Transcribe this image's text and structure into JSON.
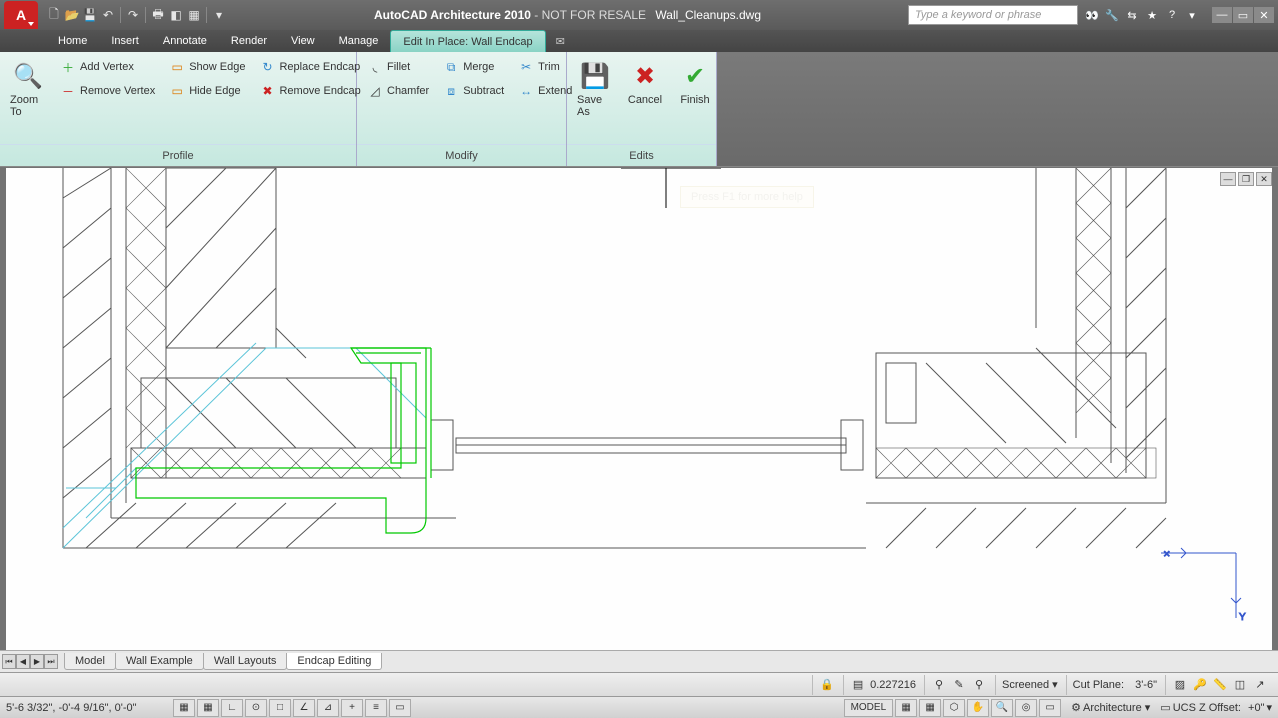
{
  "title": {
    "app": "AutoCAD Architecture 2010",
    "note": "- NOT FOR RESALE",
    "file": "Wall_Cleanups.dwg"
  },
  "search": {
    "placeholder": "Type a keyword or phrase"
  },
  "menus": {
    "home": "Home",
    "insert": "Insert",
    "annotate": "Annotate",
    "render": "Render",
    "view": "View",
    "manage": "Manage",
    "editinplace": "Edit In Place: Wall Endcap"
  },
  "ribbon": {
    "zoomto": "Zoom To",
    "addvertex": "Add Vertex",
    "removevertex": "Remove Vertex",
    "showedge": "Show Edge",
    "hideedge": "Hide Edge",
    "replaceendcap": "Replace Endcap",
    "removeendcap": "Remove Endcap",
    "fillet": "Fillet",
    "chamfer": "Chamfer",
    "merge": "Merge",
    "subtract": "Subtract",
    "trim": "Trim",
    "extend": "Extend",
    "saveas": "Save As",
    "cancel": "Cancel",
    "finish": "Finish",
    "panel_profile": "Profile",
    "panel_modify": "Modify",
    "panel_edits": "Edits"
  },
  "tooltip": "Press F1 for more help",
  "layout_tabs": {
    "model": "Model",
    "wallex": "Wall Example",
    "walllay": "Wall Layouts",
    "endcap": "Endcap Editing"
  },
  "status1": {
    "number": "0.227216",
    "screened": "Screened ▾",
    "cutplane_label": "Cut Plane:",
    "cutplane_val": "3'-6\""
  },
  "status2": {
    "coords": "5'-6 3/32\",  -0'-4 9/16\",  0'-0\"",
    "model": "MODEL",
    "arch_label": "Architecture ▾",
    "ucs_label": "UCS Z Offset:",
    "ucs_val": "+0\""
  }
}
